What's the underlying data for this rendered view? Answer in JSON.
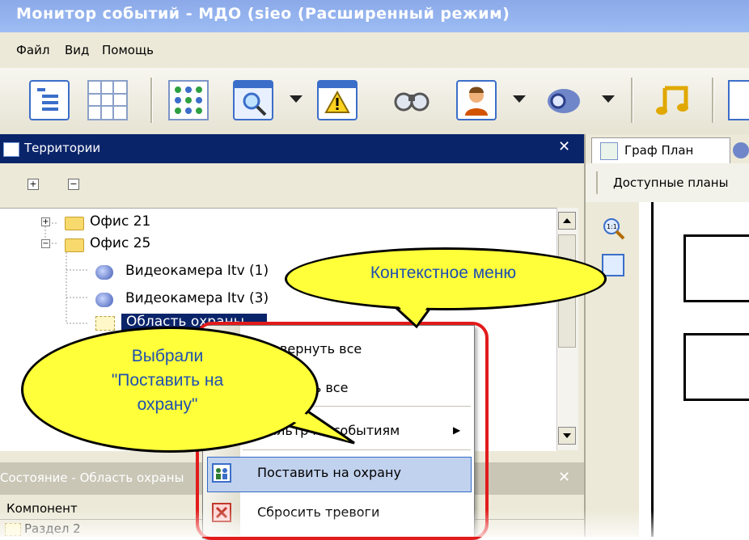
{
  "window": {
    "title": "Монитор событий - МДО (sieo (Расширенный режим)"
  },
  "menubar": {
    "items": [
      "Файл",
      "Вид",
      "Помощь"
    ]
  },
  "toolbar": {
    "icons": [
      "tree-view-icon",
      "grid-icon",
      "graph-plan-icon",
      "search-window-icon",
      "alarm-window-icon",
      "binoculars-icon",
      "person-icon",
      "camera-icon",
      "music-icon"
    ]
  },
  "territories": {
    "title": "Территории",
    "close": "✕",
    "expand_all": "+",
    "collapse_all": "−",
    "tree": [
      {
        "label": "Офис 21",
        "toggle": "+"
      },
      {
        "label": "Офис 25",
        "toggle": "−"
      },
      {
        "label": "Видеокамера Itv (1)"
      },
      {
        "label": "Видеокамера Itv (3)"
      },
      {
        "label": "Область охраны"
      }
    ]
  },
  "state_panel": {
    "title": "Состояние - Область охраны",
    "close": "✕",
    "column": "Компонент",
    "row": "Раздел 2"
  },
  "right": {
    "tab": "Граф План",
    "plans_label": "Доступные планы"
  },
  "context_menu": {
    "items": [
      {
        "label": "Развернуть все"
      },
      {
        "label": "Свернуть все"
      },
      {
        "label": "Фильтр по событиям",
        "submenu": "▶"
      },
      {
        "label": "Поставить на охрану"
      },
      {
        "label": "Сбросить тревоги"
      }
    ]
  },
  "callouts": {
    "context_menu": "Контекстное меню",
    "selected_line1": "Выбрали",
    "selected_line2": "\"Поставить на",
    "selected_line3": "охрану\""
  },
  "colors": {
    "balloon": "#ffff3a",
    "frame": "#e21b1b",
    "title_bar": "#0a246a",
    "highlight": "#c1d2ee"
  }
}
